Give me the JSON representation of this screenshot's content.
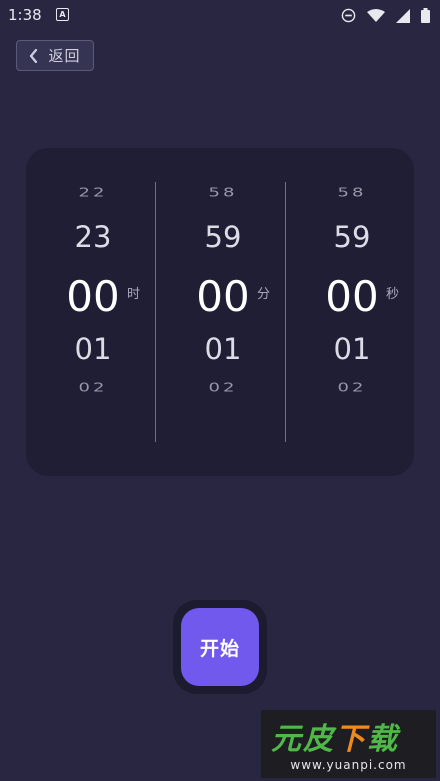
{
  "status_bar": {
    "time": "1:38",
    "app_badge": "A",
    "icons": [
      "dnd-icon",
      "wifi-icon",
      "signal-icon",
      "battery-icon"
    ]
  },
  "back_button": {
    "label": "返回",
    "icon": "chevron-left-icon"
  },
  "picker": {
    "hours": {
      "far_above": "22",
      "above": "23",
      "selected": "00",
      "below": "01",
      "far_below": "02",
      "unit": "时"
    },
    "minutes": {
      "far_above": "58",
      "above": "59",
      "selected": "00",
      "below": "01",
      "far_below": "02",
      "unit": "分"
    },
    "seconds": {
      "far_above": "58",
      "above": "59",
      "selected": "00",
      "below": "01",
      "far_below": "02",
      "unit": "秒"
    }
  },
  "start_button": {
    "label": "开始"
  },
  "watermark": {
    "logo": "元皮下载",
    "url": "www.yuanpi.com"
  },
  "colors": {
    "background": "#282641",
    "card": "#1f1e34",
    "accent": "#7159ee"
  }
}
